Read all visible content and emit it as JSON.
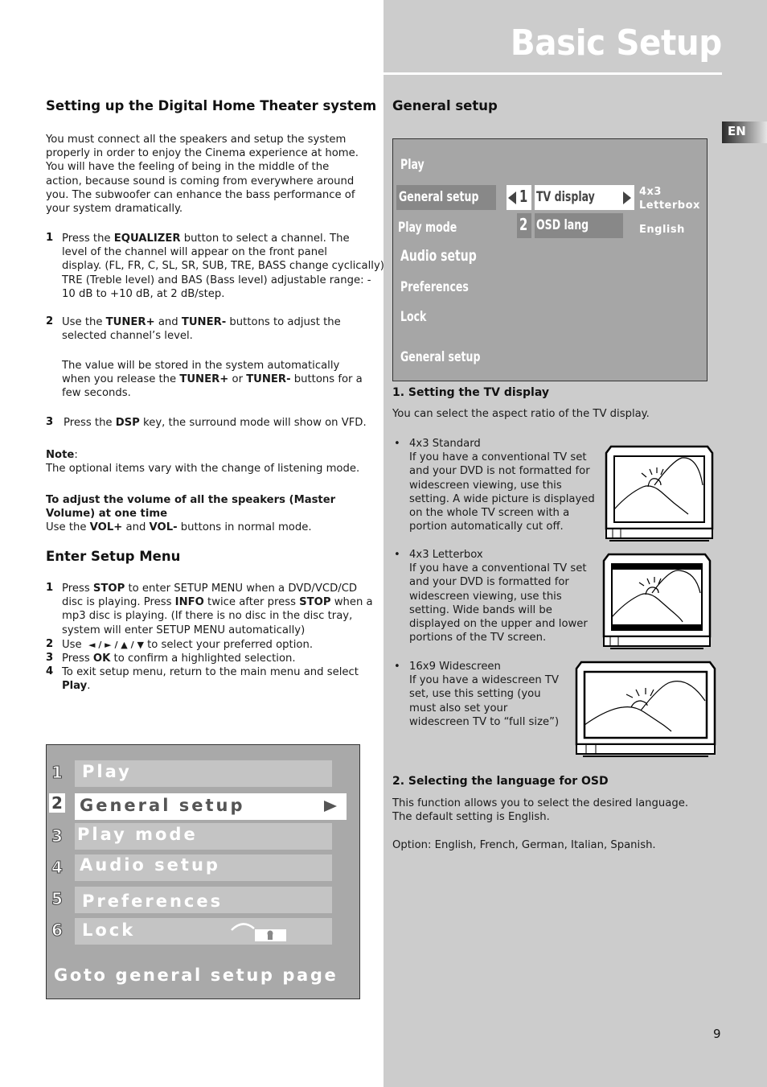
{
  "header": {
    "title": "Basic Setup",
    "language_tab": "EN"
  },
  "left": {
    "section1": {
      "heading": "Setting up the Digital Home Theater system",
      "intro": [
        "You must connect all the speakers and setup the system",
        "properly in order to enjoy the Cinema experience at home.",
        "You will have the feeling of being in the middle of the",
        "action, because sound is coming from everywhere around",
        "you. The subwoofer can enhance the bass performance of",
        "your system dramatically."
      ],
      "step1": {
        "num": "1",
        "pre": "Press the ",
        "key": "EQUALIZER",
        "post": " button to select a channel. The",
        "lines": [
          "level of the channel will appear on the front panel",
          "display. (FL, FR, C, SL, SR, SUB, TRE, BASS change cyclically)",
          "TRE (Treble level) and BAS (Bass level) adjustable range: -",
          "10 dB to +10 dB, at 2 dB/step."
        ]
      },
      "step2": {
        "num": "2",
        "a": "Use the ",
        "k1": "TUNER+",
        "b": " and ",
        "k2": "TUNER-",
        "c": " buttons to adjust the",
        "line2": "selected channel’s level."
      },
      "step2_note": {
        "line1": "The value will be stored in the system automatically",
        "a": "when you release the ",
        "k1": "TUNER+",
        "b": " or ",
        "k2": "TUNER-",
        "c": " buttons for a",
        "line3": "few seconds."
      },
      "step3": {
        "num": "3",
        "a": "Press the ",
        "key": "DSP",
        "b": " key, the surround mode will show on VFD."
      },
      "note": {
        "label": "Note",
        "colon": ":",
        "text": "The optional items vary with the change of listening mode."
      },
      "master": {
        "heading1": "To adjust the volume of all the speakers (Master",
        "heading2": "Volume) at one time",
        "a": "Use the ",
        "k1": "VOL+",
        "b": " and ",
        "k2": "VOL-",
        "c": " buttons in normal mode."
      }
    },
    "section2": {
      "heading": "Enter Setup Menu",
      "step1": {
        "num": "1",
        "a": "Press ",
        "k1": "STOP",
        "b": " to enter SETUP MENU when a DVD/VCD/CD",
        "c": "disc is playing. Press ",
        "k2": "INFO",
        "d": " twice after press ",
        "k3": "STOP",
        "e": " when a",
        "f": "mp3 disc is playing. (If there is no disc in the disc tray,",
        "g": "system will enter SETUP MENU automatically)"
      },
      "step2": {
        "num": "2",
        "a": "Use  ",
        "arrows": "◄ / ► / ▲ / ▼",
        "b": " to select your preferred option."
      },
      "step3": {
        "num": "3",
        "a": "Press ",
        "key": "OK",
        "b": " to confirm a highlighted selection."
      },
      "step4": {
        "num": "4",
        "a": "To exit setup menu, return to the main menu and select",
        "key": "Play",
        "b": "."
      }
    },
    "osd_main_menu": {
      "items": [
        {
          "num": "1",
          "label": "Play"
        },
        {
          "num": "2",
          "label": "General setup"
        },
        {
          "num": "3",
          "label": "Play mode"
        },
        {
          "num": "4",
          "label": "Audio setup"
        },
        {
          "num": "5",
          "label": "Preferences"
        },
        {
          "num": "6",
          "label": "Lock"
        }
      ],
      "selected_index": 1,
      "footer": "Goto general setup page"
    }
  },
  "right": {
    "heading": "General setup",
    "osd_general": {
      "menu": [
        "Play",
        "General setup",
        "Play mode",
        "Audio setup",
        "Preferences",
        "Lock"
      ],
      "selected": "General setup",
      "options": [
        {
          "num": "1",
          "label": "TV display",
          "value_line1": "4x3",
          "value_line2": "Letterbox"
        },
        {
          "num": "2",
          "label": "OSD lang",
          "value_line1": "English"
        }
      ],
      "footer": "General setup"
    },
    "tv_display": {
      "heading": "1. Setting the TV display",
      "intro": "You can select the aspect ratio of the TV display.",
      "bullet": "•",
      "options": [
        {
          "title": "4x3 Standard",
          "lines": [
            "If you have a conventional TV set",
            "and your DVD is not formatted for",
            "widescreen viewing, use this",
            "setting. A wide picture is displayed",
            "on the whole TV screen with a",
            "portion automatically cut off."
          ]
        },
        {
          "title": "4x3 Letterbox",
          "lines": [
            "If you have a conventional TV set",
            "and your DVD is formatted for",
            "widescreen viewing, use this",
            "setting. Wide bands will be",
            "displayed on the upper and lower",
            "portions of the TV screen."
          ]
        },
        {
          "title": "16x9 Widescreen",
          "lines": [
            "If you have a widescreen TV",
            "set, use this setting (you",
            "must also set your",
            "widescreen TV to “full size”)"
          ]
        }
      ]
    },
    "osd_lang": {
      "heading": "2. Selecting the language for OSD",
      "line1": "This function allows you to select the desired language.",
      "line2": "The default setting is English.",
      "options": "Option: English, French, German, Italian, Spanish."
    }
  },
  "footer": {
    "page_number": "9"
  }
}
